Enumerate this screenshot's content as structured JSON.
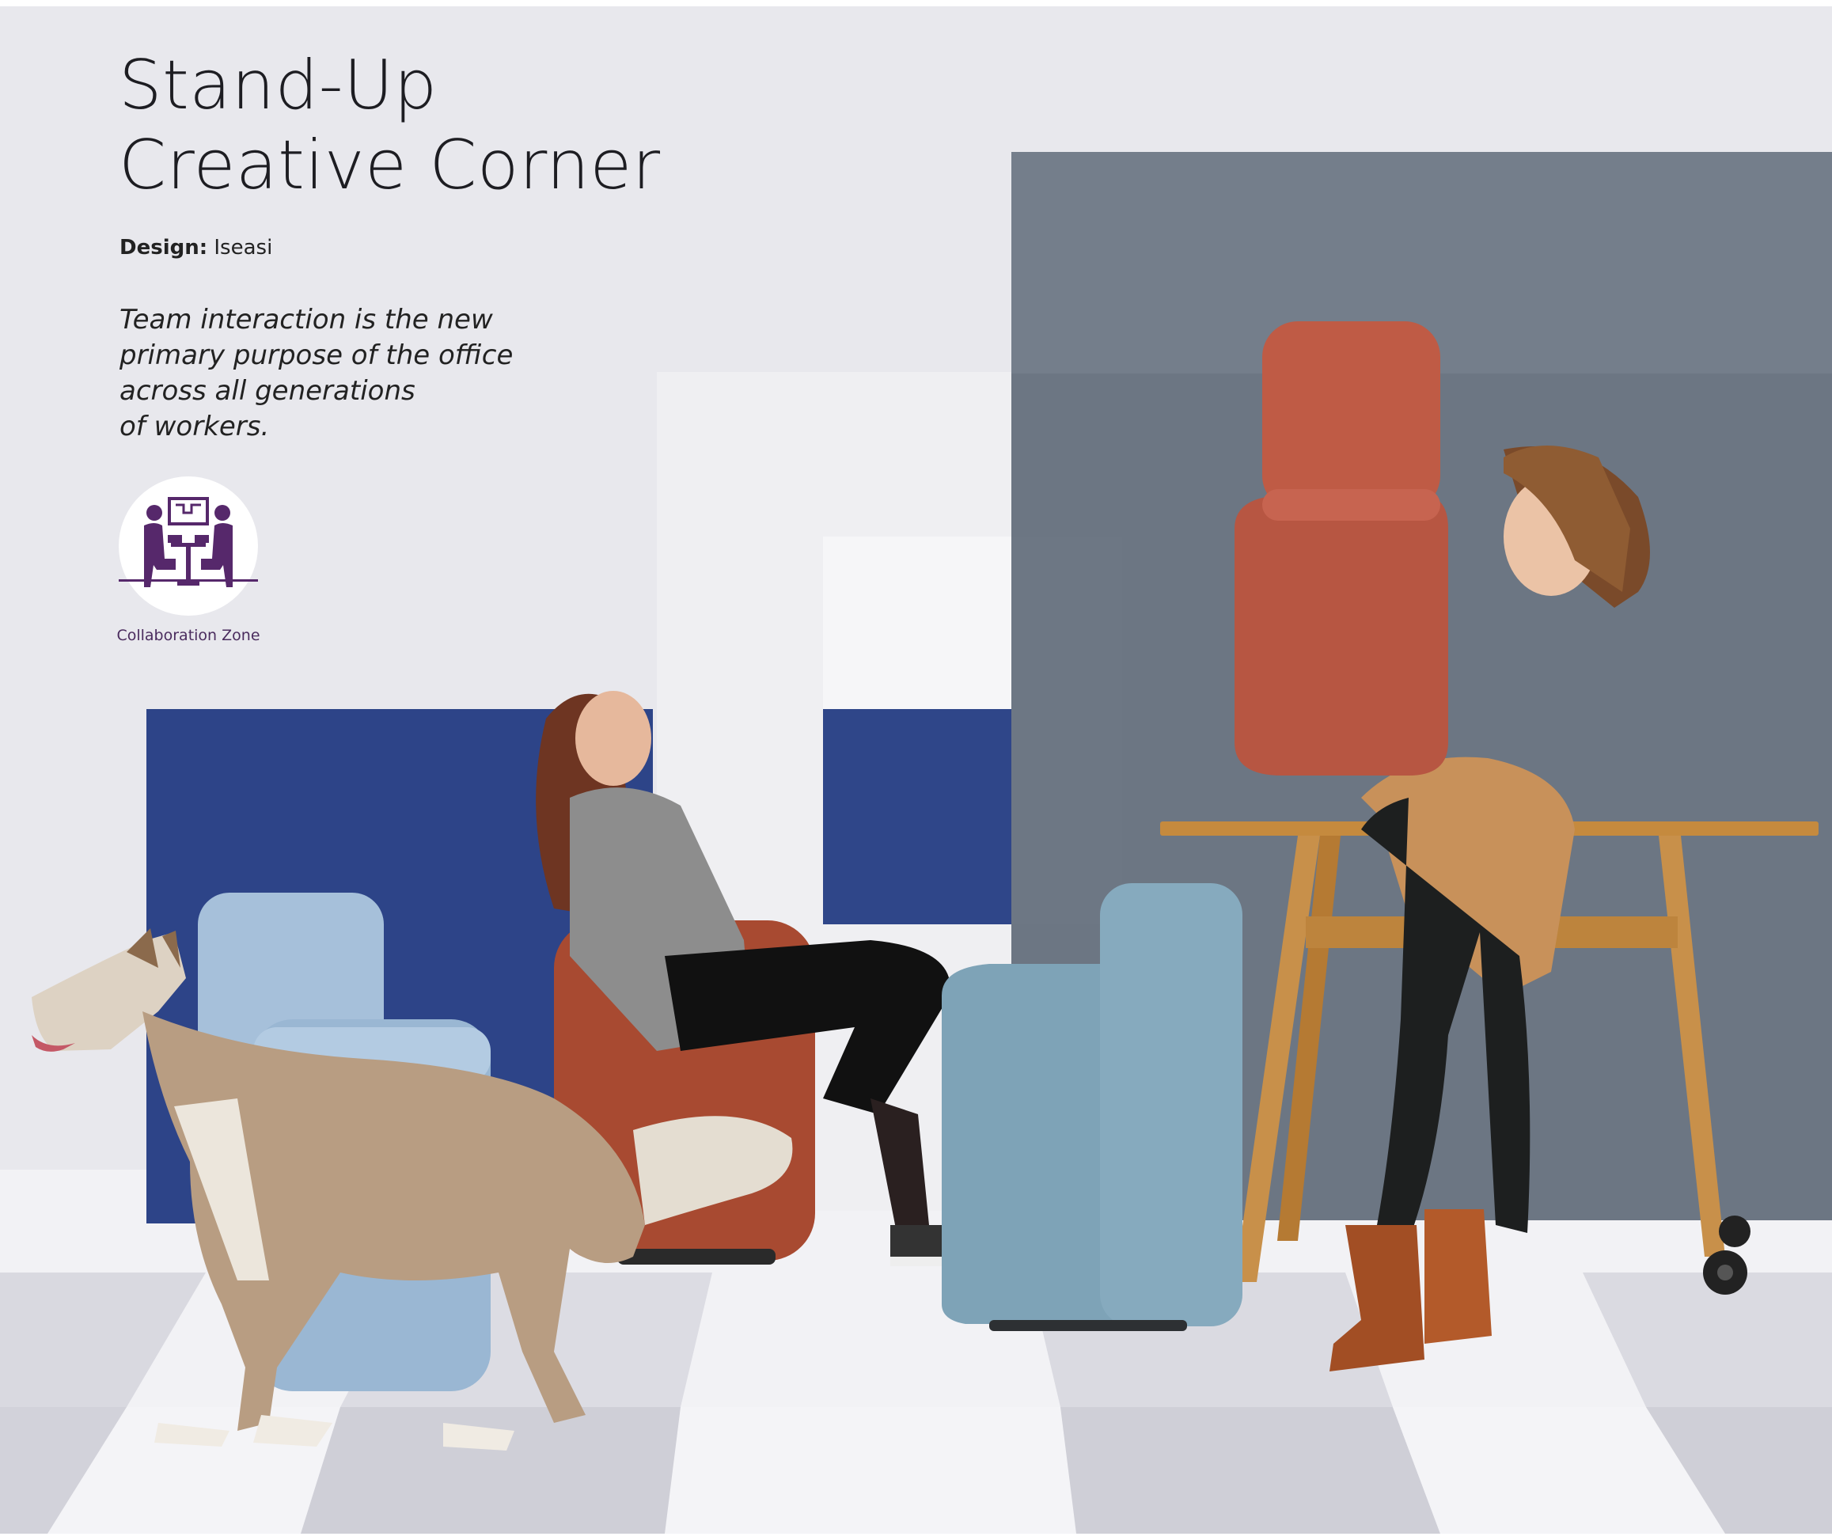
{
  "page": {
    "title_lines": [
      "Stand-Up",
      "Creative Corner"
    ],
    "design_label": "Design:",
    "designer": "Iseasi",
    "quote_lines": [
      "Team interaction is the new",
      "primary purpose of the office",
      "across all generations",
      "of workers."
    ]
  },
  "badge": {
    "icon": "collaboration-zone-icon",
    "label": "Collaboration Zone",
    "color": "#56286b"
  },
  "photo": {
    "subject": "people-with-chairs-and-dog-icon"
  }
}
